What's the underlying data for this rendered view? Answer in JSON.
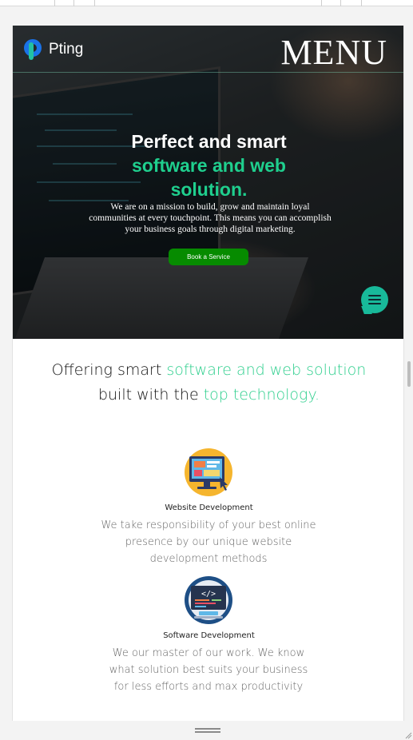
{
  "header": {
    "logo_text": "Pting",
    "menu_label": "MENU"
  },
  "hero": {
    "title_line1": "Perfect and smart",
    "title_line2": "software and web",
    "title_line3": "solution.",
    "description": "We are on a mission to build, grow and maintain loyal communities at every touchpoint. This means you can accomplish your business goals through digital marketing.",
    "cta_label": "Book a Service"
  },
  "section": {
    "title_part1": "Offering smart ",
    "title_hl1": "software and web solution",
    "title_part2": " built with the ",
    "title_hl2": "top technology."
  },
  "services": [
    {
      "name": "Website Development",
      "description": "We take responsibility of your best online presence by our unique website development methods",
      "icon": "website-development-icon"
    },
    {
      "name": "Software Development",
      "description": "We our master of our work. We know what solution best suits your business for less efforts and max productivity",
      "icon": "software-development-icon"
    }
  ],
  "colors": {
    "accent_green": "#1fcf8e",
    "cta_green": "#068b00",
    "chat_teal": "#18b99a",
    "logo_blue": "#1a73e8"
  }
}
